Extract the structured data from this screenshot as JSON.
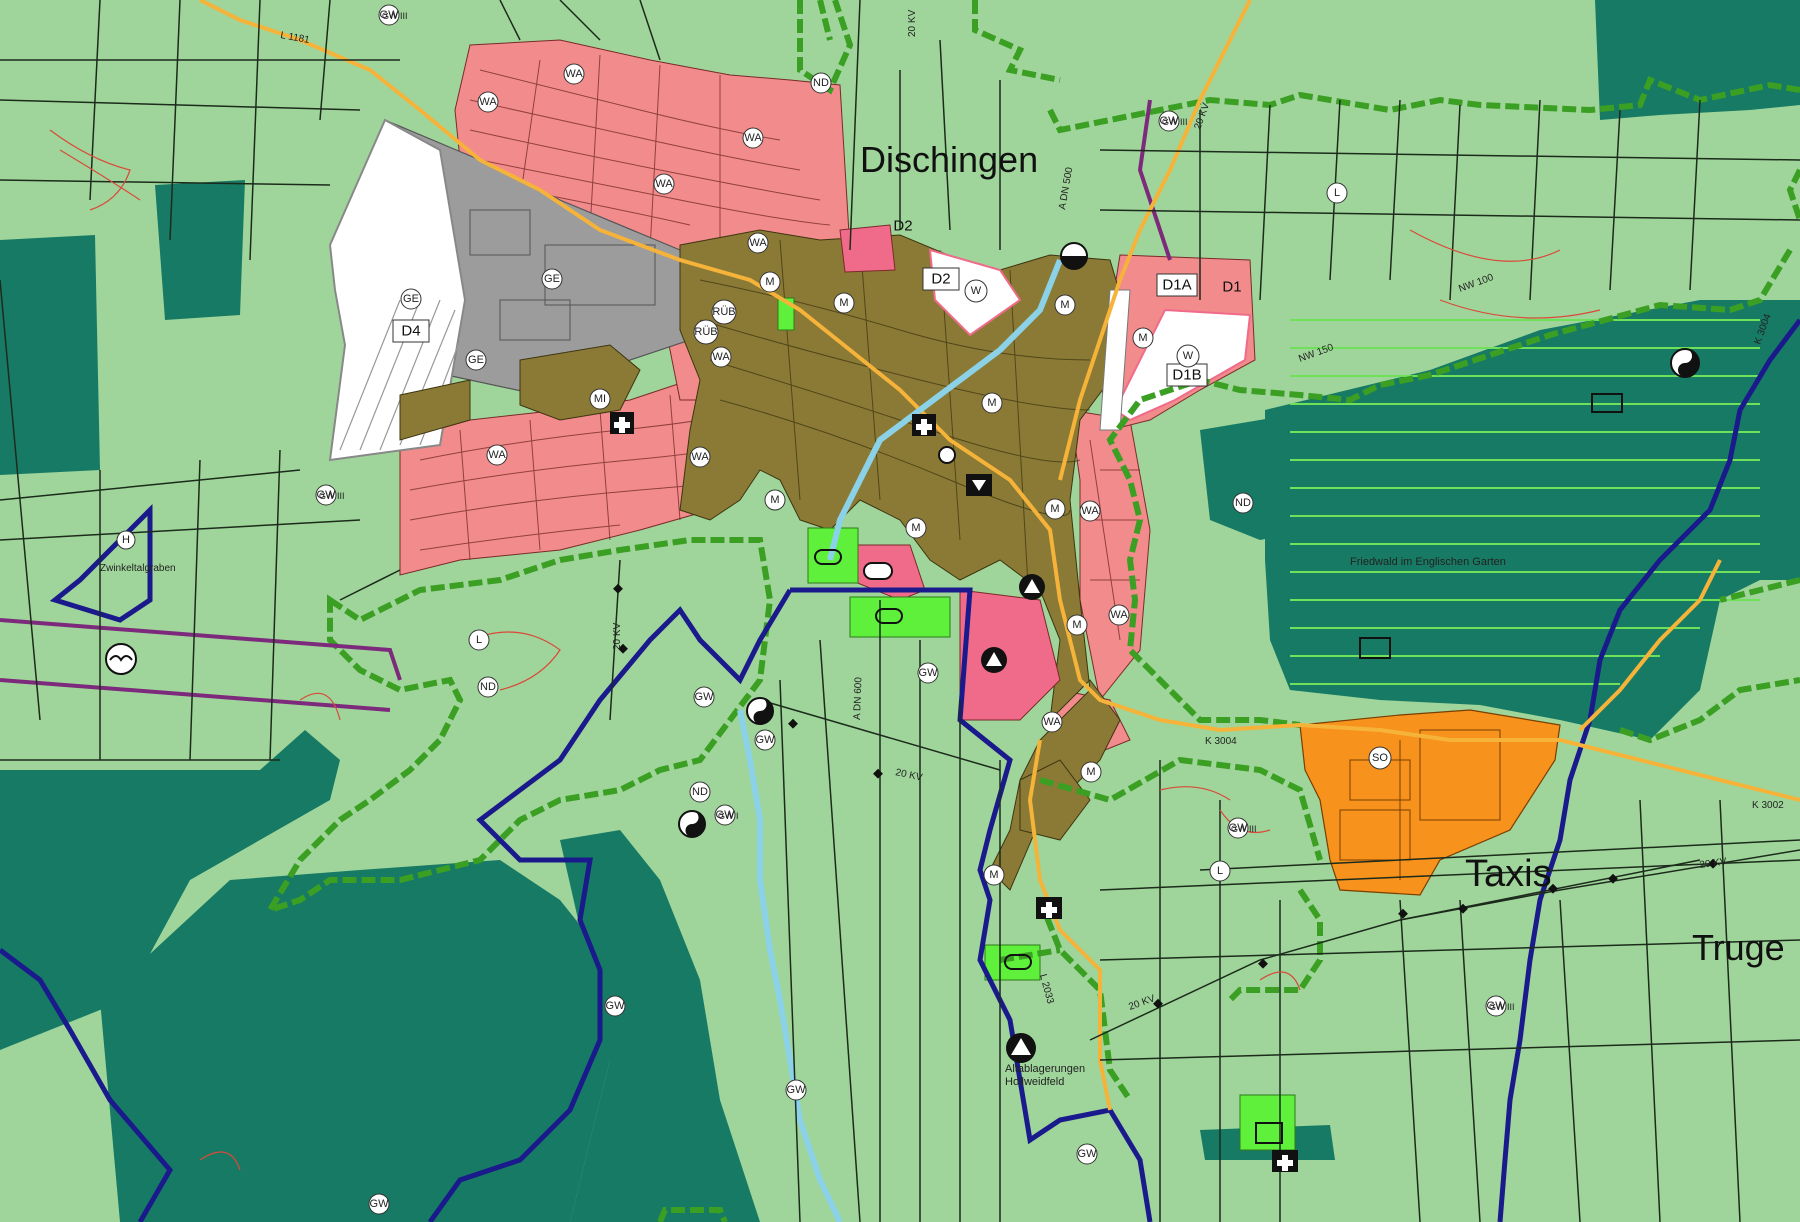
{
  "places": {
    "dischingen": "Dischingen",
    "taxis": "Taxis",
    "truge": "Truge"
  },
  "labels": {
    "friedwald": "Friedwald im Englischen Garten",
    "altablagerungen_1": "Altablagerungen",
    "altablagerungen_2": "Hollweidfeld",
    "zwinkeltal": "Zwinkeltalgraben"
  },
  "roads": {
    "l1181": "L 1181",
    "k3004": "K 3004",
    "k3004_b": "K 3004",
    "k3002": "K 3002",
    "adn500": "A DN 500",
    "adn600": "A DN 600",
    "nw100": "NW 100",
    "nw150": "NW 150",
    "l2033": "L 2033",
    "kv20_a": "20 KV",
    "kv20_b": "20 KV",
    "kv20_c": "20 KV",
    "kv20_d": "20 KV",
    "kv20_e": "20 KV",
    "kv20_f": "20 KV"
  },
  "zones": {
    "d1": "D1",
    "d1a": "D1A",
    "d1b": "D1B",
    "d2": "D2",
    "d2b": "D2",
    "d4": "D4"
  },
  "symbols": {
    "wa": "WA",
    "m": "M",
    "ge": "GE",
    "l": "L",
    "nd": "ND",
    "gw": "GW",
    "gw3": "GW III",
    "gw1": "GW I",
    "rub": "RÜB",
    "mi": "MI",
    "w": "W",
    "so": "SO",
    "h": "H"
  },
  "colors": {
    "agriculture": "#9fd59a",
    "forest": "#177a64",
    "residential": "#f28b8b",
    "mixed": "#8b7a35",
    "commercial": "#9c9c9c",
    "special": "#f7921c",
    "green_area": "#5ef03a",
    "border": "#1a1a8c",
    "green_belt": "#3a9f22",
    "water": "#8bd2e8"
  }
}
